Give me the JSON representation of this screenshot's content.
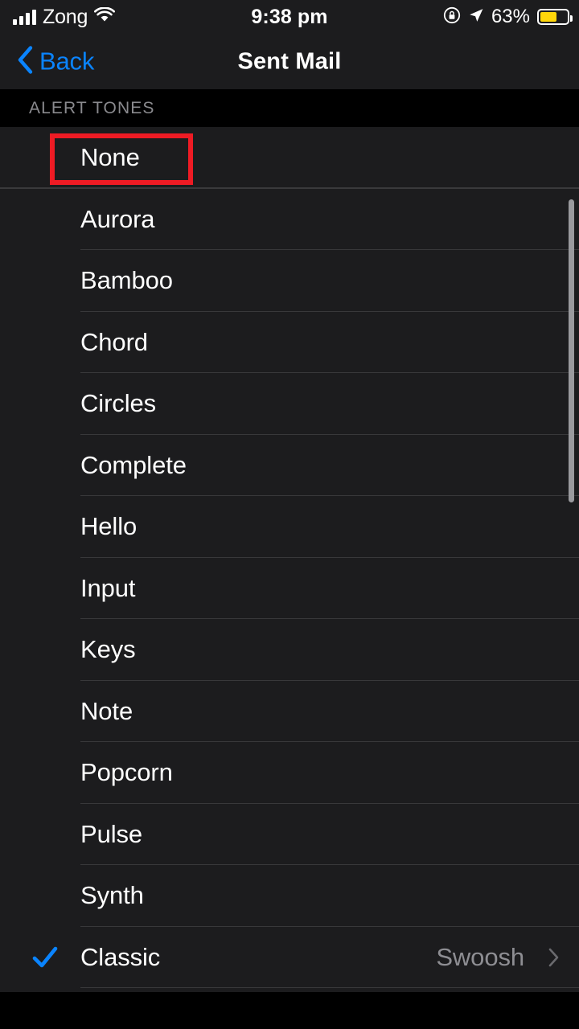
{
  "status_bar": {
    "carrier": "Zong",
    "time": "9:38 pm",
    "battery_percent": "63%",
    "battery_level": 63,
    "icons": [
      "signal-bars-icon",
      "wifi-icon",
      "rotation-lock-icon",
      "location-arrow-icon",
      "battery-icon"
    ],
    "battery_color": "#ffd60a"
  },
  "nav_bar": {
    "back_label": "Back",
    "title": "Sent Mail",
    "tint_color": "#0a84ff"
  },
  "section": {
    "header": "ALERT TONES"
  },
  "rows": [
    {
      "label": "None",
      "selected": false,
      "value": "",
      "chevron": false
    },
    {
      "label": "Aurora",
      "selected": false,
      "value": "",
      "chevron": false
    },
    {
      "label": "Bamboo",
      "selected": false,
      "value": "",
      "chevron": false
    },
    {
      "label": "Chord",
      "selected": false,
      "value": "",
      "chevron": false
    },
    {
      "label": "Circles",
      "selected": false,
      "value": "",
      "chevron": false
    },
    {
      "label": "Complete",
      "selected": false,
      "value": "",
      "chevron": false
    },
    {
      "label": "Hello",
      "selected": false,
      "value": "",
      "chevron": false
    },
    {
      "label": "Input",
      "selected": false,
      "value": "",
      "chevron": false
    },
    {
      "label": "Keys",
      "selected": false,
      "value": "",
      "chevron": false
    },
    {
      "label": "Note",
      "selected": false,
      "value": "",
      "chevron": false
    },
    {
      "label": "Popcorn",
      "selected": false,
      "value": "",
      "chevron": false
    },
    {
      "label": "Pulse",
      "selected": false,
      "value": "",
      "chevron": false
    },
    {
      "label": "Synth",
      "selected": false,
      "value": "",
      "chevron": false
    },
    {
      "label": "Classic",
      "selected": true,
      "value": "Swoosh",
      "chevron": true
    }
  ],
  "highlight": {
    "color": "#ee1b24",
    "target_label": "None"
  },
  "scrollbar": {
    "visible": true
  },
  "colors": {
    "background": "#000000",
    "row_background": "#1c1c1e",
    "separator": "#38383a",
    "primary_text": "#ffffff",
    "secondary_text": "#8e8e93",
    "accent": "#0a84ff"
  }
}
